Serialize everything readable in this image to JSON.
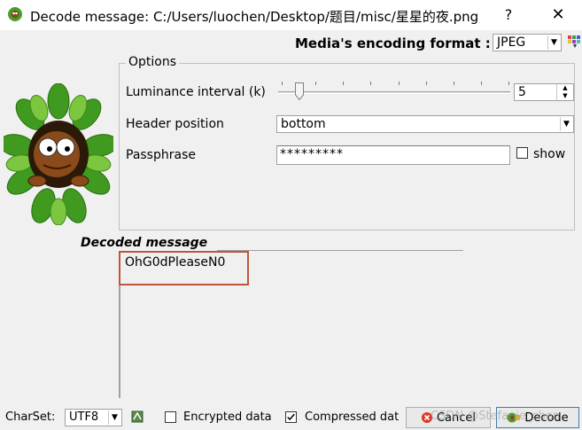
{
  "window": {
    "title": "Decode message: C:/Users/luochen/Desktop/题目/misc/星星的夜.png",
    "help_label": "?",
    "close_label": "✕"
  },
  "encoding": {
    "label": "Media's encoding format :",
    "value": "JPEG"
  },
  "options": {
    "legend": "Options",
    "luminance_label": "Luminance interval (k)",
    "luminance_value": "5",
    "header_label": "Header position",
    "header_value": "bottom",
    "passphrase_label": "Passphrase",
    "passphrase_value": "*********",
    "show_label": "show",
    "show_checked": false
  },
  "decoded": {
    "label": "Decoded message",
    "message": "OhG0dPleaseN0"
  },
  "footer": {
    "charset_label": "CharSet:",
    "charset_value": "UTF8",
    "encrypted_label": "Encrypted data",
    "encrypted_checked": false,
    "compressed_label": "Compressed dat",
    "compressed_checked": true,
    "cancel_label": "Cancel",
    "decode_label": "Decode",
    "watermark": "CSDN @Stefanie_chen"
  },
  "colors": {
    "highlight": "#c0553b",
    "window_bg": "#f0f0f0"
  },
  "icons": [
    "app-icon",
    "help-icon",
    "close-icon",
    "color-palette-icon",
    "frog-mascot",
    "charset-icon",
    "cancel-icon",
    "decode-icon"
  ]
}
